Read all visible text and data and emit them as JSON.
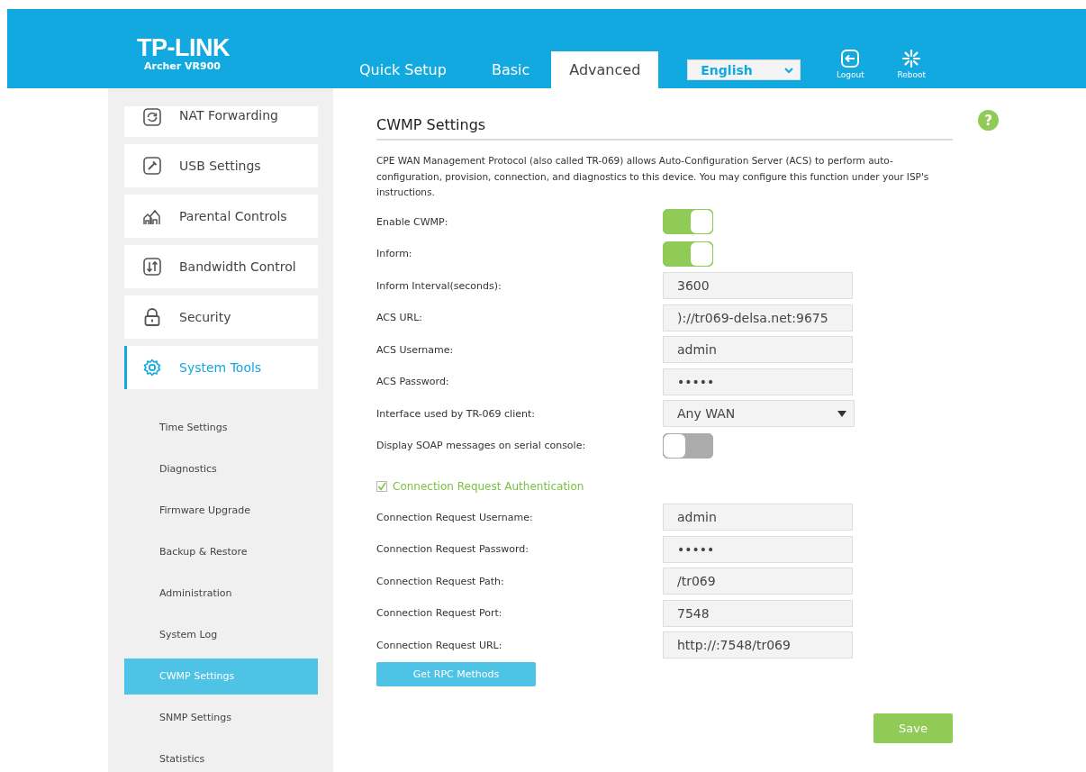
{
  "header": {
    "logo": "TP-LINK",
    "model": "Archer VR900",
    "tabs": [
      {
        "label": "Quick Setup",
        "selected": false
      },
      {
        "label": "Basic",
        "selected": false
      },
      {
        "label": "Advanced",
        "selected": true
      }
    ],
    "language": {
      "value": "English"
    },
    "actions": [
      {
        "kind": "logout",
        "label": "Logout"
      },
      {
        "kind": "reboot",
        "label": "Reboot"
      }
    ]
  },
  "sidebar": {
    "items": [
      {
        "label": "NAT Forwarding",
        "selected": false
      },
      {
        "label": "USB Settings",
        "selected": false
      },
      {
        "label": "Parental Controls",
        "selected": false
      },
      {
        "label": "Bandwidth Control",
        "selected": false
      },
      {
        "label": "Security",
        "selected": false
      },
      {
        "label": "System Tools",
        "selected": true,
        "children": [
          {
            "label": "Time Settings",
            "selected": false
          },
          {
            "label": "Diagnostics",
            "selected": false
          },
          {
            "label": "Firmware Upgrade",
            "selected": false
          },
          {
            "label": "Backup & Restore",
            "selected": false
          },
          {
            "label": "Administration",
            "selected": false
          },
          {
            "label": "System Log",
            "selected": false
          },
          {
            "label": "CWMP Settings",
            "selected": true
          },
          {
            "label": "SNMP Settings",
            "selected": false
          },
          {
            "label": "Statistics",
            "selected": false
          }
        ]
      }
    ]
  },
  "content": {
    "title": "CWMP Settings",
    "help": "?",
    "description": "CPE WAN Management Protocol (also called TR-069) allows Auto-Configuration Server (ACS) to perform auto-configuration, provision, connection, and diagnostics to this device. You may configure this function under your ISP's instructions.",
    "rows": [
      {
        "kind": "toggle",
        "label": "Enable CWMP:",
        "on": true
      },
      {
        "kind": "toggle",
        "label": "Inform:",
        "on": true
      },
      {
        "kind": "field",
        "label": "Inform Interval(seconds):",
        "value": "3600"
      },
      {
        "kind": "field",
        "label": "ACS URL:",
        "value": ")://tr069-delsa.net:9675"
      },
      {
        "kind": "field",
        "label": "ACS Username:",
        "value": "admin"
      },
      {
        "kind": "field",
        "label": "ACS Password:",
        "value": "•••••"
      },
      {
        "kind": "select",
        "label": "Interface used by TR-069 client:",
        "value": "Any WAN"
      },
      {
        "kind": "toggle",
        "label": "Display SOAP messages on serial console:",
        "on": false
      },
      {
        "kind": "checkbox",
        "label": "Connection Request Authentication",
        "checked": true
      },
      {
        "kind": "field",
        "label": "Connection Request Username:",
        "value": "admin"
      },
      {
        "kind": "field",
        "label": "Connection Request Password:",
        "value": "•••••"
      },
      {
        "kind": "field",
        "label": "Connection Request Path:",
        "value": "/tr069"
      },
      {
        "kind": "field",
        "label": "Connection Request Port:",
        "value": "7548"
      },
      {
        "kind": "field",
        "label": "Connection Request URL:",
        "value": "http://:7548/tr069"
      }
    ],
    "action_button": "Get RPC Methods",
    "save_button": "Save"
  }
}
